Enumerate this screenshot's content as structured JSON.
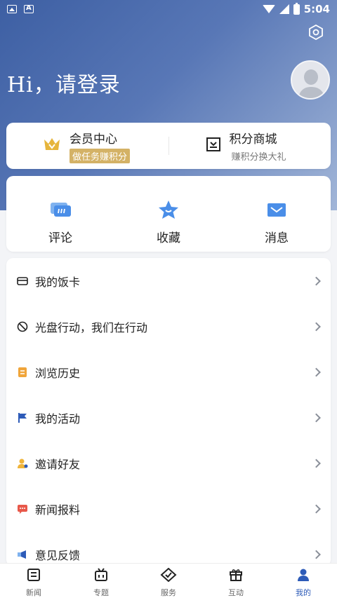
{
  "status_bar": {
    "time": "5:04"
  },
  "header": {
    "greeting": "Hi，请登录"
  },
  "member": {
    "vip_title": "会员中心",
    "vip_badge": "做任务赚积分",
    "shop_title": "积分商城",
    "shop_sub": "赚积分换大礼"
  },
  "quick_actions": [
    {
      "label": "评论",
      "icon": "comment-icon"
    },
    {
      "label": "收藏",
      "icon": "star-icon"
    },
    {
      "label": "消息",
      "icon": "mail-icon"
    }
  ],
  "menu": [
    {
      "label": "我的饭卡",
      "icon": "card-icon"
    },
    {
      "label": "光盘行动，我们在行动",
      "icon": "prohibit-icon"
    },
    {
      "label": "浏览历史",
      "icon": "history-icon"
    },
    {
      "label": "我的活动",
      "icon": "flag-icon"
    },
    {
      "label": "邀请好友",
      "icon": "invite-user-icon"
    },
    {
      "label": "新闻报料",
      "icon": "chat-report-icon"
    },
    {
      "label": "意见反馈",
      "icon": "feedback-icon"
    }
  ],
  "tabs": [
    {
      "label": "新闻",
      "icon": "news-icon"
    },
    {
      "label": "专题",
      "icon": "tv-icon"
    },
    {
      "label": "服务",
      "icon": "service-icon"
    },
    {
      "label": "互动",
      "icon": "gift-icon"
    },
    {
      "label": "我的",
      "icon": "user-icon",
      "active": true
    }
  ],
  "colors": {
    "header_gradient_start": "#3d5fa3",
    "header_gradient_end": "#a2b6d8",
    "accent": "#2d5bb8",
    "gold": "#d4b266"
  }
}
